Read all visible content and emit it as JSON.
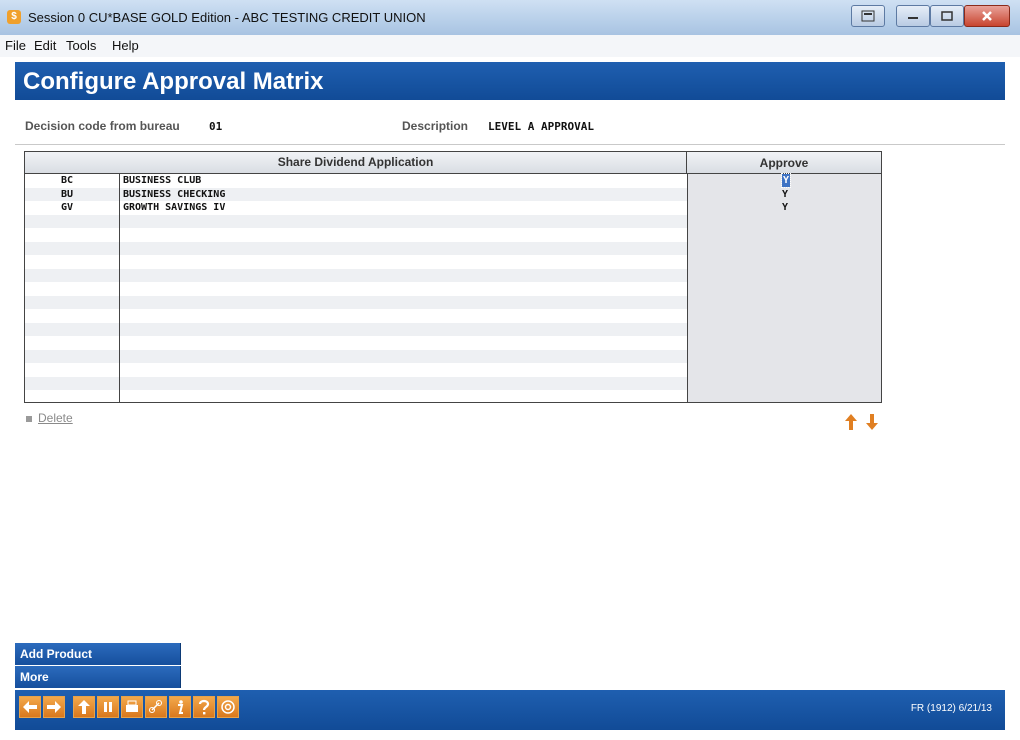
{
  "window": {
    "title": "Session 0 CU*BASE GOLD Edition - ABC TESTING CREDIT UNION"
  },
  "menu": [
    "File",
    "Edit",
    "Tools",
    "Help"
  ],
  "header": {
    "title": "Configure Approval Matrix"
  },
  "fields": {
    "decision_label": "Decision code from bureau",
    "decision_value": "01",
    "description_label": "Description",
    "description_value": "LEVEL A APPROVAL"
  },
  "grid": {
    "col_application": "Share Dividend Application",
    "col_approve": "Approve",
    "rows": [
      {
        "code": "BC",
        "name": "BUSINESS CLUB",
        "approve": "Y"
      },
      {
        "code": "BU",
        "name": "BUSINESS CHECKING",
        "approve": "Y"
      },
      {
        "code": "GV",
        "name": "GROWTH SAVINGS IV",
        "approve": "Y"
      }
    ]
  },
  "options": {
    "delete_label": "Delete"
  },
  "function_buttons": {
    "add_product": "Add Product",
    "more": "More"
  },
  "toolbar_icons": [
    "back-arrow-icon",
    "forward-arrow-icon",
    "up-arrow-icon",
    "pause-icon",
    "print-icon",
    "link-icon",
    "info-icon",
    "help-icon",
    "email-icon"
  ],
  "footer": {
    "status": "FR (1912) 6/21/13"
  },
  "colors": {
    "header_blue": "#1f5fb0",
    "accent_orange": "#e07f22"
  }
}
